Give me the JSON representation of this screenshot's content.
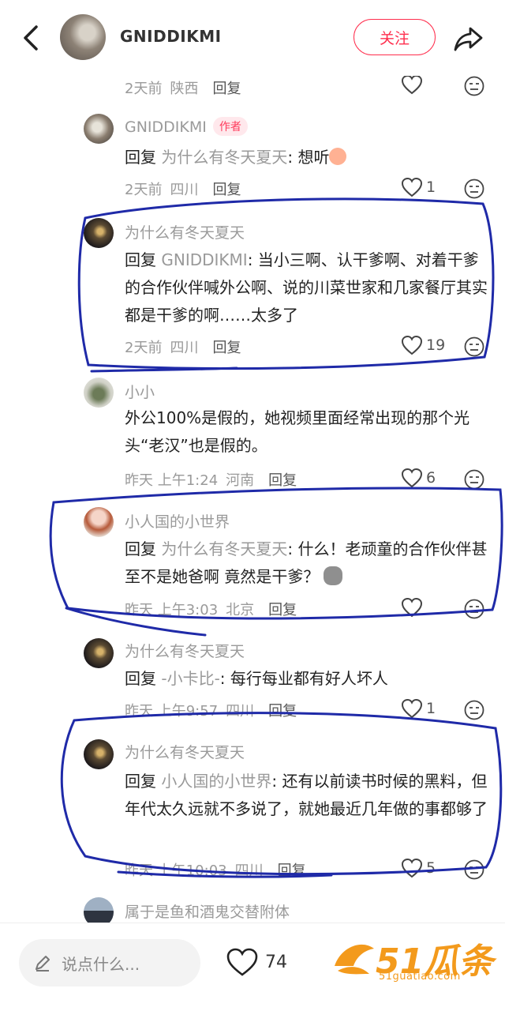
{
  "header": {
    "username": "GNIDDIKMI",
    "follow_label": "关注"
  },
  "comments": [
    {
      "meta_time": "2天前",
      "meta_loc": "陕西",
      "reply": "回复",
      "likes": ""
    },
    {
      "user": "GNIDDIKMI",
      "badge": "作者",
      "prefix": "回复 ",
      "target": "为什么有冬天夏天",
      "body": ": 想听",
      "meta_time": "2天前",
      "meta_loc": "四川",
      "reply": "回复",
      "likes": "1"
    },
    {
      "user": "为什么有冬天夏天",
      "prefix": "回复 ",
      "target": "GNIDDIKMI",
      "body": ": 当小三啊、认干爹啊、对着干爹的合作伙伴喊外公啊、说的川菜世家和几家餐厅其实都是干爹的啊……太多了",
      "meta_time": "2天前",
      "meta_loc": "四川",
      "reply": "回复",
      "likes": "19"
    },
    {
      "user": "小小",
      "body": "外公100%是假的，她视频里面经常出现的那个光头“老汉”也是假的。",
      "meta_time": "昨天 上午1:24",
      "meta_loc": "河南",
      "reply": "回复",
      "likes": "6"
    },
    {
      "user": "小人国的小世界",
      "prefix": "回复 ",
      "target": "为什么有冬天夏天",
      "body": ": 什么！老顽童的合作伙伴甚至不是她爸啊 竟然是干爹？",
      "meta_time": "昨天 上午3:03",
      "meta_loc": "北京",
      "reply": "回复",
      "likes": ""
    },
    {
      "user": "为什么有冬天夏天",
      "prefix": "回复 ",
      "target": "-小卡比-",
      "body": ": 每行每业都有好人坏人",
      "meta_time": "昨天 上午9:57",
      "meta_loc": "四川",
      "reply": "回复",
      "likes": "1"
    },
    {
      "user": "为什么有冬天夏天",
      "prefix": "回复 ",
      "target": "小人国的小世界",
      "body": ": 还有以前读书时候的黑料，但年代太久远就不多说了，就她最近几年做的事都够了",
      "meta_time": "昨天 上午10:03",
      "meta_loc": "四川",
      "reply": "回复",
      "likes": "5"
    },
    {
      "user": "属于是鱼和酒鬼交替附体"
    }
  ],
  "bottom": {
    "input_placeholder": "说点什么...",
    "likes": "74"
  },
  "watermark": {
    "logo_text": "51瓜条",
    "url": "51guatiao.com"
  },
  "colors": {
    "accent": "#ff2e4d",
    "annotation_ink": "#1f2aa8",
    "watermark": "#f39a1c"
  }
}
